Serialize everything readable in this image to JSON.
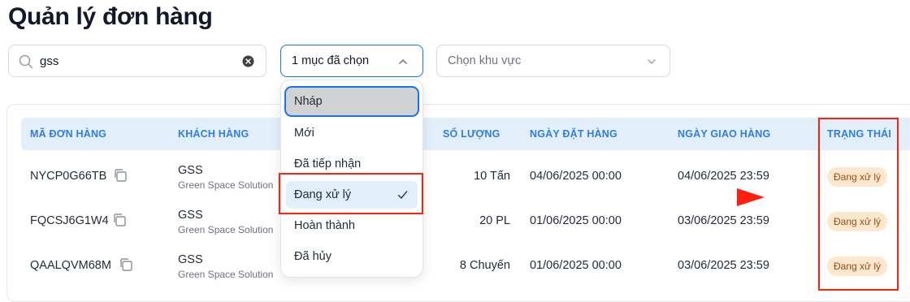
{
  "page": {
    "title": "Quản lý đơn hàng"
  },
  "filters": {
    "search": {
      "value": "gss"
    },
    "status": {
      "value": "1 mục đã chọn"
    },
    "region": {
      "placeholder": "Chọn khu vực"
    }
  },
  "status_options": [
    {
      "label": "Nháp",
      "highlighted": true
    },
    {
      "label": "Mới"
    },
    {
      "label": "Đã tiếp nhận"
    },
    {
      "label": "Đang xử lý",
      "selected": true
    },
    {
      "label": "Hoàn thành"
    },
    {
      "label": "Đã hủy"
    }
  ],
  "table": {
    "columns": [
      "MÃ ĐƠN HÀNG",
      "KHÁCH HÀNG",
      "SỐ LƯỢNG",
      "NGÀY ĐẶT HÀNG",
      "NGÀY GIAO HÀNG",
      "TRẠNG THÁI"
    ],
    "rows": [
      {
        "code": "NYCP0G66TB",
        "customer": "GSS",
        "customer_full": "Green Space Solution",
        "quantity": "10 Tấn",
        "order_date": "04/06/2025 00:00",
        "delivery_date": "04/06/2025 23:59",
        "status": "Đang xử lý"
      },
      {
        "code": "FQCSJ6G1W4",
        "customer": "GSS",
        "customer_full": "Green Space Solution",
        "quantity": "20 PL",
        "order_date": "01/06/2025 00:00",
        "delivery_date": "03/06/2025 23:59",
        "status": "Đang xử lý"
      },
      {
        "code": "QAALQVM68M",
        "customer": "GSS",
        "customer_full": "Green Space Solution",
        "quantity": "8 Chuyến",
        "order_date": "01/06/2025 00:00",
        "delivery_date": "03/06/2025 23:59",
        "status": "Đang xử lý"
      }
    ]
  },
  "colors": {
    "accent": "#1a73e8",
    "header_bg": "#e3eefb",
    "badge_bg": "#fde8cf",
    "badge_text": "#9a4d0a",
    "annotation": "#ff1f0f"
  },
  "icons": [
    "search-icon",
    "clear-icon",
    "chevron-up-icon",
    "chevron-down-icon",
    "copy-icon",
    "check-icon",
    "arrow-right-icon"
  ]
}
